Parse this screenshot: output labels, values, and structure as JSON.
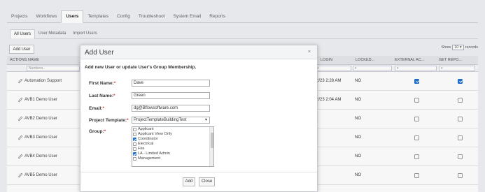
{
  "top_tabs": [
    {
      "label": "Projects",
      "active": false
    },
    {
      "label": "Workflows",
      "active": false
    },
    {
      "label": "Users",
      "active": true
    },
    {
      "label": "Templates",
      "active": false
    },
    {
      "label": "Config",
      "active": false
    },
    {
      "label": "Troubleshoot",
      "active": false
    },
    {
      "label": "System Email",
      "active": false
    },
    {
      "label": "Reports",
      "active": false
    }
  ],
  "sub_tabs": [
    {
      "label": "All Users",
      "active": true
    },
    {
      "label": "User Metadata",
      "active": false
    },
    {
      "label": "Import Users",
      "active": false
    }
  ],
  "toolbar": {
    "add_user_label": "Add User",
    "show_prefix": "Show",
    "show_value": "10",
    "show_suffix": "records"
  },
  "table": {
    "headers": [
      "ACTIONS",
      "NAME",
      "LOGIN",
      "LOCKED...",
      "EXTERNAL AC...",
      "GET REPO..."
    ],
    "filter_placeholder": "Numbers..",
    "rows": [
      {
        "name": "Automation Support",
        "login": "2/23 2:28 AM",
        "locked": "NO",
        "external": true,
        "reports": true
      },
      {
        "name": "AVB1 Demo User",
        "login": "2/23 2:04 AM",
        "locked": "NO",
        "external": false,
        "reports": false
      },
      {
        "name": "AVB2 Demo User",
        "login": "",
        "locked": "NO",
        "external": false,
        "reports": false
      },
      {
        "name": "AVB3 Demo User",
        "login": "",
        "locked": "NO",
        "external": false,
        "reports": false
      },
      {
        "name": "AVB4 Demo User",
        "login": "",
        "locked": "NO",
        "external": false,
        "reports": false
      },
      {
        "name": "AVB5 Demo User",
        "login": "",
        "locked": "NO",
        "external": false,
        "reports": false
      }
    ]
  },
  "modal": {
    "title": "Add User",
    "close": "×",
    "intro": "Add new User or update User's Group Membership.",
    "first_name_label": "First Name:",
    "first_name_value": "Dave",
    "last_name_label": "Last Name:",
    "last_name_value": "Green",
    "email_label": "Email:",
    "email_value": "dg@Bflowsoftware.com",
    "template_label": "Project Template:",
    "template_value": "ProjectTemplateBuildingTest",
    "group_label": "Group:",
    "groups": [
      {
        "label": "Applicant",
        "checked": false
      },
      {
        "label": "Applicant View Only",
        "checked": false
      },
      {
        "label": "Coordinator",
        "checked": true
      },
      {
        "label": "Electrical",
        "checked": false
      },
      {
        "label": "Fire",
        "checked": false
      },
      {
        "label": "LA - Limited Admin",
        "checked": true
      },
      {
        "label": "Management",
        "checked": false
      }
    ],
    "add_label": "Add",
    "close_label": "Close"
  },
  "colors": {
    "accent": "#1f6fd1",
    "required": "#d33333"
  }
}
